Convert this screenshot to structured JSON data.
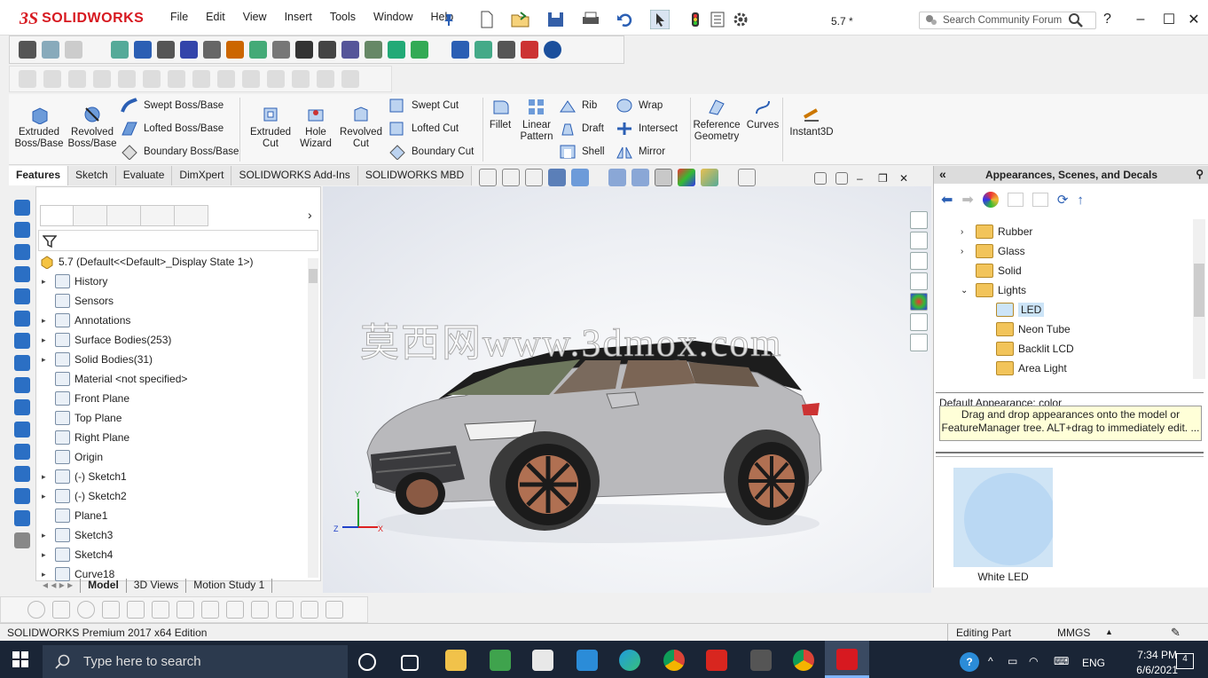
{
  "app": {
    "brand_mark": "3S",
    "brand_name": "SOLIDWORKS",
    "document_title": "5.7 *"
  },
  "menu": [
    "File",
    "Edit",
    "View",
    "Insert",
    "Tools",
    "Window",
    "Help"
  ],
  "search": {
    "placeholder": "Search Community Forum"
  },
  "help_glyph": "?",
  "command_manager": {
    "extruded_boss": "Extruded Boss/Base",
    "revolved_boss": "Revolved Boss/Base",
    "swept_boss": "Swept Boss/Base",
    "lofted_boss": "Lofted Boss/Base",
    "boundary_boss": "Boundary Boss/Base",
    "extruded_cut": "Extruded Cut",
    "hole_wizard": "Hole Wizard",
    "revolved_cut": "Revolved Cut",
    "swept_cut": "Swept Cut",
    "lofted_cut": "Lofted Cut",
    "boundary_cut": "Boundary Cut",
    "fillet": "Fillet",
    "linear_pattern": "Linear Pattern",
    "rib": "Rib",
    "draft": "Draft",
    "shell": "Shell",
    "wrap": "Wrap",
    "intersect": "Intersect",
    "mirror": "Mirror",
    "reference_geometry": "Reference Geometry",
    "curves": "Curves",
    "instant3d": "Instant3D"
  },
  "tabs": [
    "Features",
    "Sketch",
    "Evaluate",
    "DimXpert",
    "SOLIDWORKS Add-Ins",
    "SOLIDWORKS MBD"
  ],
  "feature_tree": {
    "root": "5.7  (Default<<Default>_Display State 1>)",
    "items": [
      {
        "label": "History",
        "expandable": true
      },
      {
        "label": "Sensors",
        "expandable": false
      },
      {
        "label": "Annotations",
        "expandable": true
      },
      {
        "label": "Surface Bodies(253)",
        "expandable": true
      },
      {
        "label": "Solid Bodies(31)",
        "expandable": true
      },
      {
        "label": "Material <not specified>",
        "expandable": false
      },
      {
        "label": "Front Plane",
        "expandable": false
      },
      {
        "label": "Top Plane",
        "expandable": false
      },
      {
        "label": "Right Plane",
        "expandable": false
      },
      {
        "label": "Origin",
        "expandable": false
      },
      {
        "label": "(-) Sketch1",
        "expandable": true
      },
      {
        "label": "(-) Sketch2",
        "expandable": true
      },
      {
        "label": "Plane1",
        "expandable": false
      },
      {
        "label": "Sketch3",
        "expandable": true
      },
      {
        "label": "Sketch4",
        "expandable": true
      },
      {
        "label": "Curve18",
        "expandable": true
      }
    ]
  },
  "bottom_tabs": [
    "Model",
    "3D Views",
    "Motion Study 1"
  ],
  "viewport": {
    "watermark": "莫西网www.3dmox.com",
    "axis_x": "X",
    "axis_y": "Y",
    "axis_z": "Z"
  },
  "task_pane": {
    "title": "Appearances, Scenes, and Decals",
    "items": [
      {
        "label": "Rubber",
        "level": 1,
        "expandable": true
      },
      {
        "label": "Glass",
        "level": 1,
        "expandable": true
      },
      {
        "label": "Solid",
        "level": 1,
        "expandable": false
      },
      {
        "label": "Lights",
        "level": 1,
        "expandable": true,
        "expanded": true
      },
      {
        "label": "LED",
        "level": 2,
        "selected": true
      },
      {
        "label": "Neon Tube",
        "level": 2
      },
      {
        "label": "Backlit LCD",
        "level": 2
      },
      {
        "label": "Area Light",
        "level": 2
      }
    ],
    "default_appearance": "Default Appearance: color",
    "hint": "Drag and drop appearances onto the model or FeatureManager tree.  ALT+drag to immediately edit. ...",
    "thumbnail_label": "White LED"
  },
  "status": {
    "edition": "SOLIDWORKS Premium 2017 x64 Edition",
    "mode": "Editing Part",
    "units": "MMGS",
    "units_arrow": "▲"
  },
  "taskbar": {
    "search_placeholder": "Type here to search",
    "lang": "ENG",
    "time": "7:34 PM",
    "date": "6/6/2021",
    "notifications": "4"
  },
  "colors": {
    "brand": "#d71920",
    "taskbar": "#1a2536",
    "selection": "#cce4f7",
    "hint_bg": "#ffffd8"
  }
}
